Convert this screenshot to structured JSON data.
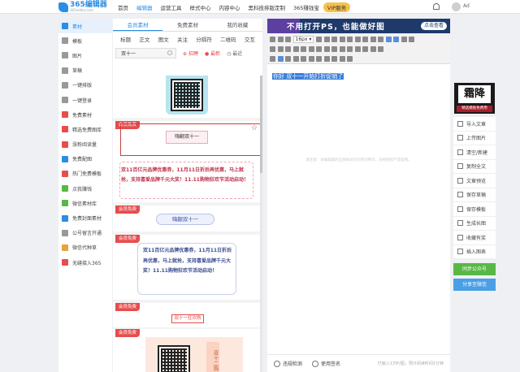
{
  "app": {
    "logo_name": "365编辑器",
    "logo_sub": "365editor.com"
  },
  "nav": [
    {
      "label": "首页",
      "active": false
    },
    {
      "label": "编辑器",
      "active": true
    },
    {
      "label": "运营工具",
      "active": false
    },
    {
      "label": "样式中心",
      "active": false
    },
    {
      "label": "内容中心",
      "active": false
    },
    {
      "label": "黑科技排版定制",
      "active": false
    },
    {
      "label": "365赚钱宝",
      "active": false
    },
    {
      "label": "VIP服务",
      "active": false
    }
  ],
  "user": {
    "name": "Ad"
  },
  "sidebar": [
    {
      "label": "素材",
      "icon": "folder-icon",
      "color": "#2b8de4",
      "active": true
    },
    {
      "label": "模板",
      "icon": "template-icon",
      "color": "#999999"
    },
    {
      "label": "图片",
      "icon": "image-icon",
      "color": "#999999"
    },
    {
      "label": "草稿",
      "icon": "draft-icon",
      "color": "#999999"
    },
    {
      "label": "一键排版",
      "icon": "layout-icon",
      "color": "#999999"
    },
    {
      "label": "一键登录",
      "icon": "login-icon",
      "color": "#999999"
    },
    {
      "label": "免费素材",
      "icon": "free-material-icon",
      "color": "#e84c4c"
    },
    {
      "label": "精选免费图库",
      "icon": "gallery-icon",
      "color": "#e84c4c"
    },
    {
      "label": "涨粉阅读量",
      "icon": "growth-icon",
      "color": "#e84c4c"
    },
    {
      "label": "免费配图",
      "icon": "picture-icon",
      "color": "#2b8de4"
    },
    {
      "label": "热门免费模板",
      "icon": "hot-template-icon",
      "color": "#e84c4c"
    },
    {
      "label": "点我赚钱",
      "icon": "money-icon",
      "color": "#58b846"
    },
    {
      "label": "微信素材库",
      "icon": "wechat-library-icon",
      "color": "#58b846"
    },
    {
      "label": "免费封面素材",
      "icon": "cover-icon",
      "color": "#2b8de4"
    },
    {
      "label": "公号留言开通",
      "icon": "comment-icon",
      "color": "#999999"
    },
    {
      "label": "微信代种草",
      "icon": "seed-icon",
      "color": "#e8a23c"
    },
    {
      "label": "无缝接入365",
      "icon": "connect-icon",
      "color": "#e84c4c"
    }
  ],
  "materials": {
    "tabs": [
      {
        "label": "会员素材",
        "active": true
      },
      {
        "label": "免费素材",
        "active": false
      },
      {
        "label": "我的收藏",
        "active": false
      }
    ],
    "categories": [
      "标题",
      "正文",
      "图文",
      "关注",
      "分隔符",
      "二维码",
      "交互"
    ],
    "search_value": "双十一",
    "filters": [
      "招聘",
      "最新",
      "最近"
    ],
    "vip_tag": "会员免费",
    "card_titles": [
      "嗨翻双十一",
      "嗨翻双十一",
      "双十一狂欢购",
      "双十二购"
    ],
    "promo_text_1": "双11百亿元品牌优惠券，11月11日折后再优惠，马上就抢，支持喜爱品牌千元大奖！11.11购物狂欢节活动启动！",
    "promo_text_2": "双11百亿元品牌优惠券，11月11日折后再优惠，马上就抢，支持喜爱品牌千元大奖！11.11购物狂欢节活动启动！"
  },
  "editor": {
    "banner_text": "不用打开PS，也能做好图",
    "banner_button": "点击查看",
    "font_size": "16px",
    "content_selected": "你好 双十一开始打折促销了",
    "footnote": "请注意：本编辑器的全部样式均为原创制作，未经授权严禁复制。",
    "bottom_options": [
      "违规检测",
      "使用签名"
    ],
    "word_count": "已输入13字/图，预计阅读时间1分钟"
  },
  "right_panel": {
    "ad_text": "霜降",
    "ad_sub": "精选模板免费用",
    "items": [
      "导入文章",
      "上传图片",
      "清空/新建",
      "复制全文",
      "文章预览",
      "保存草稿",
      "保存模板",
      "生成长图",
      "收藏有奖",
      "插入图表"
    ],
    "green_button": "同步公众号",
    "blue_button": "分享至微信"
  }
}
